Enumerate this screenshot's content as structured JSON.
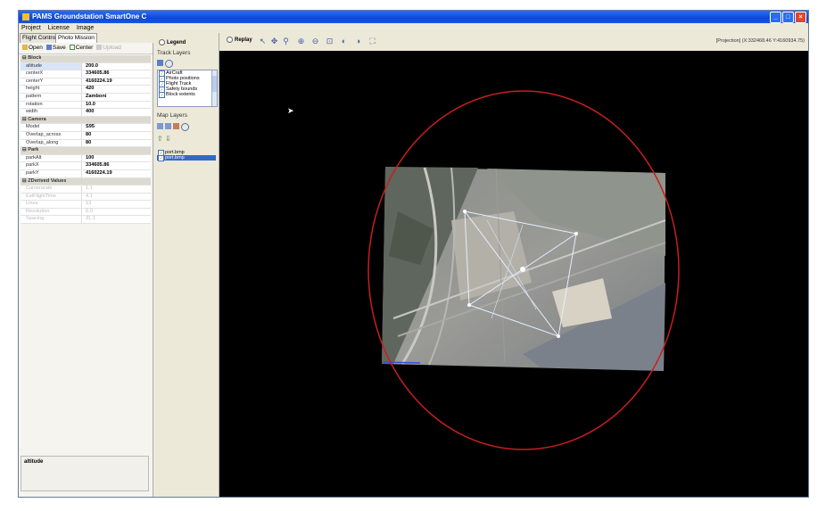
{
  "window": {
    "title": "PAMS Groundstation SmartOne C"
  },
  "menu": [
    "Project",
    "License",
    "Image"
  ],
  "tabs": [
    "Flight Control",
    "Photo Mission"
  ],
  "left_toolbar": {
    "open": "Open",
    "save": "Save",
    "center": "Center",
    "upload": "Upload"
  },
  "properties": [
    {
      "type": "category",
      "label": "Block"
    },
    {
      "key": "altitude",
      "value": "200.0",
      "selected": true
    },
    {
      "key": "centerX",
      "value": "334605.86"
    },
    {
      "key": "centerY",
      "value": "4160224.19"
    },
    {
      "key": "height",
      "value": "420"
    },
    {
      "key": "pattern",
      "value": "Zamboni"
    },
    {
      "key": "rotation",
      "value": "10.0"
    },
    {
      "key": "width",
      "value": "400"
    },
    {
      "type": "category",
      "label": "Camera"
    },
    {
      "key": "Model",
      "value": "S95"
    },
    {
      "key": "Overlap_across",
      "value": "80"
    },
    {
      "key": "Overlap_along",
      "value": "80"
    },
    {
      "type": "category",
      "label": "Park"
    },
    {
      "key": "parkAlt",
      "value": "100"
    },
    {
      "key": "parkX",
      "value": "334605.86"
    },
    {
      "key": "parkY",
      "value": "4160224.19"
    },
    {
      "type": "category",
      "label": "ZDerived Values"
    },
    {
      "key": "Camerarate",
      "value": "1.1",
      "dim": true
    },
    {
      "key": "EstFlightTime",
      "value": "4.1",
      "dim": true
    },
    {
      "key": "Lines",
      "value": "13",
      "dim": true
    },
    {
      "key": "Resolution",
      "value": "6.0",
      "dim": true
    },
    {
      "key": "Spacing",
      "value": "31.1",
      "dim": true
    }
  ],
  "description": {
    "title": "altitude"
  },
  "mid_panel": {
    "legend_label": "Legend",
    "track_layers_title": "Track Layers",
    "track_layers": [
      "AirCraft",
      "Photo positions",
      "Flight Track",
      "Safety bounds",
      "Block extents"
    ],
    "map_layers_title": "Map Layers",
    "map_layers": [
      {
        "label": "port.bmp",
        "selected": false
      },
      {
        "label": "port.bmp",
        "selected": true
      }
    ]
  },
  "toolbar": {
    "replay_label": "Replay",
    "tools": [
      "select-tool",
      "pan-tool",
      "zoom-tool",
      "zoom-in",
      "zoom-out",
      "zoom-area",
      "zoom-prev",
      "zoom-next",
      "zoom-full"
    ],
    "projection": "[Projection]  (X:332468.46  Y:4160934.75)"
  },
  "colors": {
    "title_bar": "#0a49d6",
    "map_bg": "#000000",
    "safety_circle": "#c81e1e",
    "selection": "#316ac5"
  }
}
